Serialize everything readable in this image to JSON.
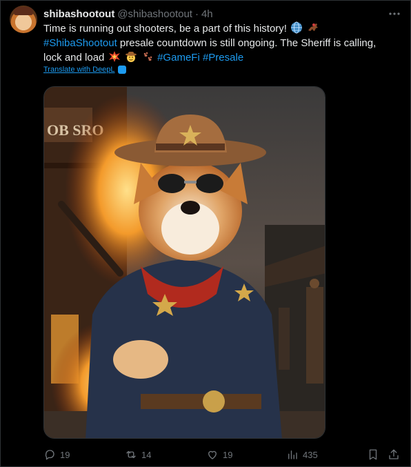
{
  "author": {
    "display_name": "shibashootout",
    "handle": "@shibashootout",
    "separator": "·",
    "time": "4h"
  },
  "tweet": {
    "line1_text": "Time is running out shooters, be a part of this history!",
    "line1_emojis": [
      "globe-emoji",
      "horse-racing-emoji"
    ],
    "line2_hashtag": "#ShibaShootout",
    "line2_text": " presale countdown is still ongoing. The Sheriff is calling,",
    "line3_text": "lock and load",
    "line3_emojis": [
      "explosion-emoji",
      "cowboy-face-emoji",
      "paw-prints-emoji"
    ],
    "hashtag_gamefi": "#GameFi",
    "hashtag_presale": "#Presale"
  },
  "translate": {
    "label": "Translate with DeepL"
  },
  "media": {
    "description_icon": "shiba-cowboy-sheriff-image",
    "sign_text": "OB SRO"
  },
  "actions": {
    "replies": "19",
    "reposts": "14",
    "likes": "19",
    "views": "435"
  },
  "colors": {
    "background": "#000000",
    "text": "#e7e9ea",
    "muted": "#71767b",
    "link": "#1d9bf0"
  }
}
